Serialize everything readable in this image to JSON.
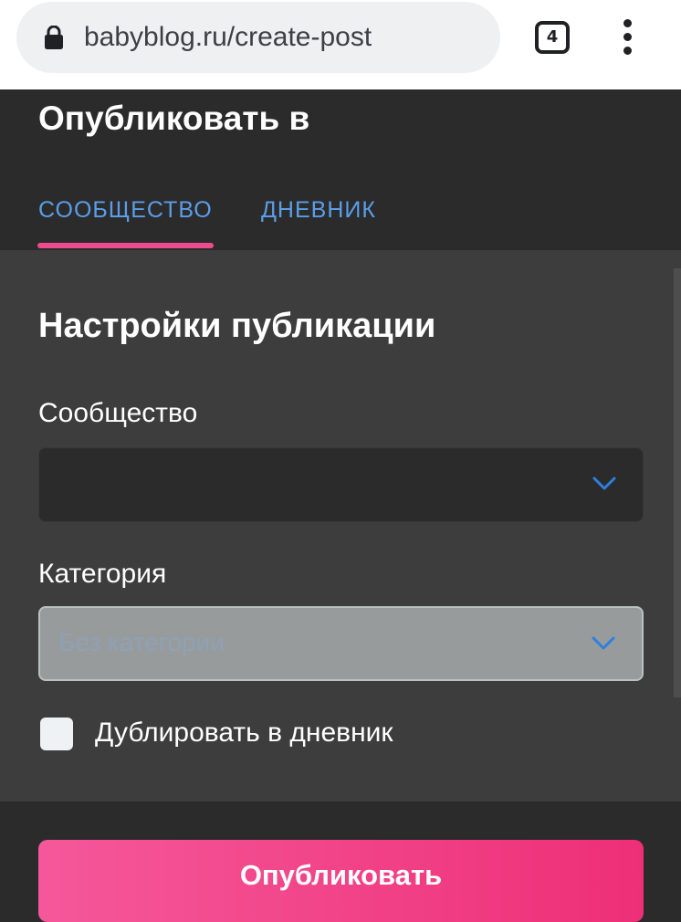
{
  "browser": {
    "url": "babyblog.ru/create-post",
    "tabs_count": "4"
  },
  "header": {
    "title": "Опубликовать в",
    "tabs": [
      {
        "label": "СООБЩЕСТВО",
        "active": true
      },
      {
        "label": "ДНЕВНИК",
        "active": false
      }
    ]
  },
  "settings": {
    "title": "Настройки публикации",
    "community_label": "Сообщество",
    "community_value": "",
    "category_label": "Категория",
    "category_placeholder": "Без категории",
    "duplicate_label": "Дублировать в дневник",
    "duplicate_checked": false
  },
  "footer": {
    "publish_label": "Опубликовать"
  },
  "colors": {
    "accent_pink": "#ec4c8e",
    "tab_blue": "#5b9ee8",
    "chevron_blue": "#2f7fe0",
    "background_dark": "#2b2b2b",
    "panel": "#3d3d3d"
  },
  "icons": [
    "lock-icon",
    "tab-switcher-icon",
    "more-vert-icon",
    "chevron-down-icon"
  ]
}
